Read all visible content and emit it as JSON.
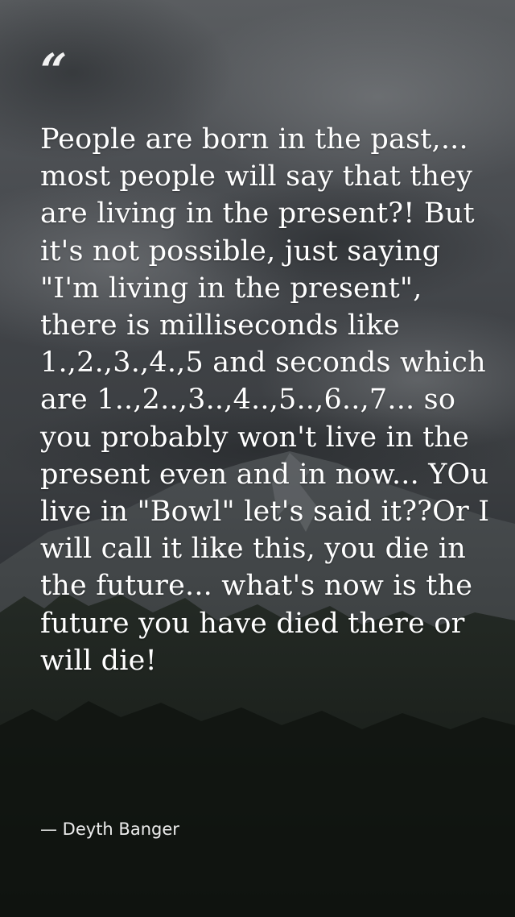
{
  "quote": {
    "mark": "“",
    "text": "People are born in the past,... most people will say that they are living in the present?! But it's not possible, just saying \"I'm living in the present\", there is milliseconds like 1.,2.,3.,4.,5 and seconds which are 1..,2..,3..,4..,5..,6..,7... so you probably won't live in the present even and in now... YOu live in \"Bowl\" let's said it??Or I will call it like this, you die in the future... what's now is the future you have died there or will die!",
    "author": "— Deyth Banger"
  },
  "background": {
    "sky_color": "#55585c",
    "mountain_color": "#3a3e40",
    "forest_color": "#1b201c"
  }
}
